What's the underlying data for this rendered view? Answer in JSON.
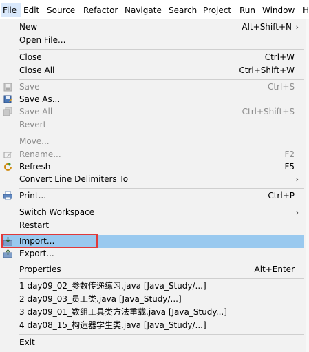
{
  "menubar": {
    "items": [
      "File",
      "Edit",
      "Source",
      "Refactor",
      "Navigate",
      "Search",
      "Project",
      "Run",
      "Window",
      "H"
    ]
  },
  "file_menu": {
    "new": {
      "label": "New",
      "shortcut": "Alt+Shift+N"
    },
    "open_file": {
      "label": "Open File..."
    },
    "close": {
      "label": "Close",
      "shortcut": "Ctrl+W"
    },
    "close_all": {
      "label": "Close All",
      "shortcut": "Ctrl+Shift+W"
    },
    "save": {
      "label": "Save",
      "shortcut": "Ctrl+S",
      "icon": "save-icon"
    },
    "save_as": {
      "label": "Save As...",
      "icon": "save-as-icon"
    },
    "save_all": {
      "label": "Save All",
      "shortcut": "Ctrl+Shift+S",
      "icon": "save-all-icon"
    },
    "revert": {
      "label": "Revert"
    },
    "move": {
      "label": "Move..."
    },
    "rename": {
      "label": "Rename...",
      "shortcut": "F2",
      "icon": "rename-icon"
    },
    "refresh": {
      "label": "Refresh",
      "shortcut": "F5",
      "icon": "refresh-icon"
    },
    "convert": {
      "label": "Convert Line Delimiters To"
    },
    "print": {
      "label": "Print...",
      "shortcut": "Ctrl+P",
      "icon": "print-icon"
    },
    "switch_workspace": {
      "label": "Switch Workspace"
    },
    "restart": {
      "label": "Restart"
    },
    "import": {
      "label": "Import...",
      "icon": "import-icon"
    },
    "export": {
      "label": "Export...",
      "icon": "export-icon"
    },
    "properties": {
      "label": "Properties",
      "shortcut": "Alt+Enter"
    },
    "recent": [
      "1 day09_02_参数传递练习.java  [Java_Study/...]",
      "2 day09_03_员工类.java  [Java_Study/...]",
      "3 day09_01_数组工具类方法重载.java  [Java_Study...]",
      "4 day08_15_构造器学生类.java  [Java_Study/...]"
    ],
    "exit": {
      "label": "Exit"
    }
  },
  "colors": {
    "menu_bg": "#f2f2f2",
    "highlight": "#99c9ef",
    "annotation_box": "#e03a3a",
    "disabled_text": "#8c8c8c"
  }
}
